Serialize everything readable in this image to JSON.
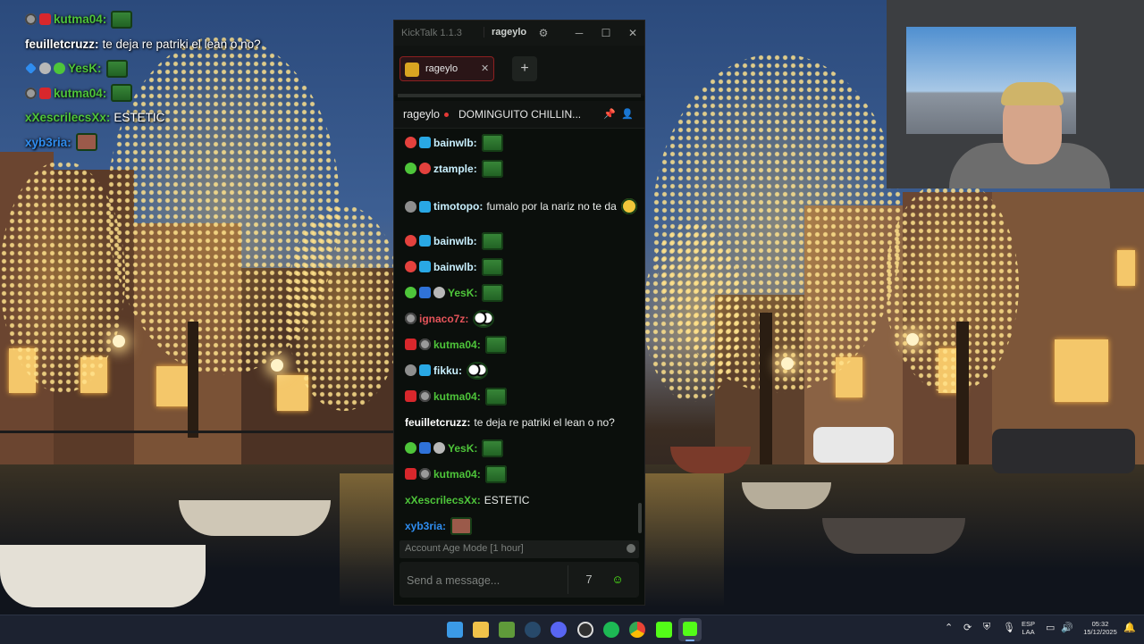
{
  "overlay_chat": [
    {
      "badges": [
        "skull",
        "red"
      ],
      "user": "kutma04",
      "color": "#4ec53a",
      "text": "",
      "emote": "green"
    },
    {
      "badges": [],
      "user": "feuilletcruzz",
      "color": "#ffffff",
      "text": "te deja re patriki el lean o no?",
      "emote": ""
    },
    {
      "badges": [
        "sword",
        "moon",
        "green"
      ],
      "user": "YesK",
      "color": "#4ec53a",
      "text": "",
      "emote": "green"
    },
    {
      "badges": [
        "skull",
        "red"
      ],
      "user": "kutma04",
      "color": "#4ec53a",
      "text": "",
      "emote": "green"
    },
    {
      "badges": [],
      "user": "xXescrilecsXx",
      "color": "#4ec53a",
      "text": "ESTETIC",
      "emote": ""
    },
    {
      "badges": [],
      "user": "xyb3ria",
      "color": "#2f8df0",
      "text": "",
      "emote": "face"
    }
  ],
  "kicktalk": {
    "app_name": "KickTalk 1.1.3",
    "user": "rageylo",
    "tab_label": "rageylo",
    "channel": "rageylo",
    "stream_title": "DOMINGUITO CHILLIN...",
    "add_tab_label": "+",
    "mode_label": "Account Age Mode [1 hour]",
    "input_placeholder": "Send a message...",
    "messages": [
      {
        "badges": [
          "sub",
          "blue"
        ],
        "user": "bainwlb",
        "color": "#c9f0ff",
        "text": "",
        "emote": "green"
      },
      {
        "badges": [
          "green",
          "sub"
        ],
        "user": "ztample",
        "color": "#c9f0ff",
        "text": "",
        "emote": "green"
      },
      {
        "badges": [
          "cog",
          "blue"
        ],
        "user": "timotopo",
        "color": "#c9f0ff",
        "text": "fumalo por la nariz no te da",
        "emote": "yel"
      },
      {
        "badges": [
          "sub",
          "blue"
        ],
        "user": "bainwlb",
        "color": "#c9f0ff",
        "text": "",
        "emote": "green"
      },
      {
        "badges": [
          "sub",
          "blue"
        ],
        "user": "bainwlb",
        "color": "#c9f0ff",
        "text": "",
        "emote": "green"
      },
      {
        "badges": [
          "green",
          "hammer",
          "moon"
        ],
        "user": "YesK",
        "color": "#4ec53a",
        "text": "",
        "emote": "green"
      },
      {
        "badges": [
          "skull"
        ],
        "user": "ignaco7z",
        "color": "#e5545a",
        "text": "",
        "emote": "eyes"
      },
      {
        "badges": [
          "red",
          "skull"
        ],
        "user": "kutma04",
        "color": "#4ec53a",
        "text": "",
        "emote": "green"
      },
      {
        "badges": [
          "cog",
          "blue"
        ],
        "user": "fikku",
        "color": "#c9f0ff",
        "text": "",
        "emote": "eyes"
      },
      {
        "badges": [
          "red",
          "skull"
        ],
        "user": "kutma04",
        "color": "#4ec53a",
        "text": "",
        "emote": "green"
      },
      {
        "badges": [],
        "user": "feuilletcruzz",
        "color": "#ffffff",
        "text": "te deja re patriki el lean o no?",
        "emote": ""
      },
      {
        "badges": [
          "green",
          "hammer",
          "moon"
        ],
        "user": "YesK",
        "color": "#4ec53a",
        "text": "",
        "emote": "green"
      },
      {
        "badges": [
          "red",
          "skull"
        ],
        "user": "kutma04",
        "color": "#4ec53a",
        "text": "",
        "emote": "green"
      },
      {
        "badges": [],
        "user": "xXescrilecsXx",
        "color": "#4ec53a",
        "text": "ESTETIC",
        "emote": ""
      },
      {
        "badges": [],
        "user": "xyb3ria",
        "color": "#2f8df0",
        "text": "",
        "emote": "face"
      }
    ]
  },
  "taskbar": {
    "apps": [
      "windows-start",
      "file-explorer",
      "minecraft",
      "steam",
      "discord",
      "obs",
      "spotify",
      "chrome",
      "kick",
      "kicktalk"
    ],
    "lang_line1": "ESP",
    "lang_line2": "LAA",
    "time": "05:32",
    "date": "15/12/2025"
  },
  "colors": {
    "accent_red": "#e53935",
    "kick_green": "#53fc18"
  }
}
